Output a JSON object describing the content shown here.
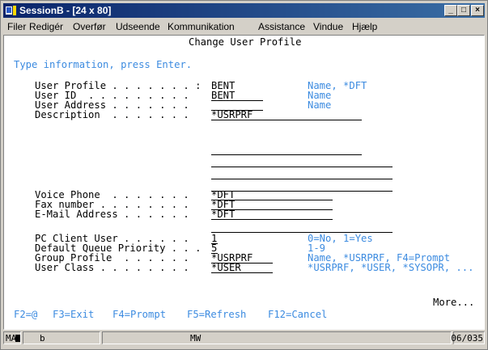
{
  "window": {
    "title": "SessionB - [24 x 80]"
  },
  "menu": [
    "Filer",
    "Redigér",
    "Overfør",
    "Udseende",
    "Kommunikation",
    "Assistance",
    "Vindue",
    "Hjælp"
  ],
  "screen": {
    "header": "Change User Profile",
    "instruction": "Type information, press Enter.",
    "fields": {
      "user_profile": {
        "label": "User Profile . . . . . . . :",
        "value": "BENT",
        "hint": "Name, *DFT"
      },
      "user_id": {
        "label": "User ID  . . . . . . . . .",
        "value": "BENT",
        "hint": "Name"
      },
      "user_address": {
        "label": "User Address . . . . . . .",
        "value": "",
        "hint": "Name"
      },
      "description": {
        "label": "Description  . . . . . . .",
        "value": "*USRPRF"
      },
      "voice_phone": {
        "label": "Voice Phone  . . . . . . .",
        "value": "*DFT"
      },
      "fax_number": {
        "label": "Fax number . . . . . . . .",
        "value": "*DFT"
      },
      "email": {
        "label": "E-Mail Address . . . . . .",
        "value": "*DFT"
      },
      "pc_client_user": {
        "label": "PC Client User . . . . . .",
        "value": "1",
        "hint": "0=No, 1=Yes"
      },
      "queue_priority": {
        "label": "Default Queue Priority . . .",
        "value": "5",
        "hint": "1-9"
      },
      "group_profile": {
        "label": "Group Profile  . . . . . .",
        "value": "*USRPRF",
        "hint": "Name, *USRPRF, F4=Prompt"
      },
      "user_class": {
        "label": "User Class . . . . . . . .",
        "value": "*USER",
        "hint": "*USRPRF, *USER, *SYSOPR, ..."
      }
    },
    "more": "More...",
    "fkeys": {
      "f2": "F2=@",
      "f3": "F3=Exit",
      "f4": "F4=Prompt",
      "f5": "F5=Refresh",
      "f12": "F12=Cancel"
    }
  },
  "statusbar": {
    "mode": "MA",
    "indicator": "b",
    "mw": "MW",
    "position": "06/035"
  }
}
